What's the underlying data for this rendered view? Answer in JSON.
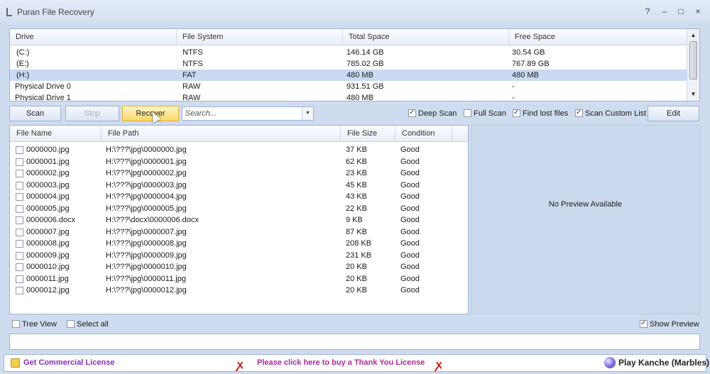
{
  "window": {
    "title": "Puran File Recovery",
    "controls": {
      "help": "?",
      "minimize": "–",
      "maximize": "□",
      "close": "×"
    }
  },
  "drives": {
    "headers": [
      "Drive",
      "File System",
      "Total Space",
      "Free Space"
    ],
    "rows": [
      {
        "drive": "(C:)",
        "fs": "NTFS",
        "total": "146.14 GB",
        "free": "30.54 GB"
      },
      {
        "drive": "(E:)",
        "fs": "NTFS",
        "total": "785.02 GB",
        "free": "767.89 GB"
      },
      {
        "drive": "(H:)",
        "fs": "FAT",
        "total": "480 MB",
        "free": "480 MB"
      },
      {
        "drive": "Physical Drive 0",
        "fs": "RAW",
        "total": "931.51 GB",
        "free": "-"
      },
      {
        "drive": "Physical Drive 1",
        "fs": "RAW",
        "total": "480 MB",
        "free": "-"
      }
    ],
    "selected_index": 2
  },
  "toolbar": {
    "scan": "Scan",
    "stop": "Stop",
    "recover": "Recover",
    "search_placeholder": "Search...",
    "deep_scan": "Deep Scan",
    "full_scan": "Full Scan",
    "find_lost_files": "Find lost files",
    "scan_custom_list": "Scan Custom List",
    "edit": "Edit",
    "deep_scan_checked": true,
    "full_scan_checked": false,
    "find_lost_files_checked": true,
    "scan_custom_list_checked": true
  },
  "files": {
    "headers": [
      "File Name",
      "File Path",
      "File Size",
      "Condition"
    ],
    "rows": [
      {
        "name": "0000000.jpg",
        "path": "H:\\???\\jpg\\0000000.jpg",
        "size": "37 KB",
        "condition": "Good"
      },
      {
        "name": "0000001.jpg",
        "path": "H:\\???\\jpg\\0000001.jpg",
        "size": "62 KB",
        "condition": "Good"
      },
      {
        "name": "0000002.jpg",
        "path": "H:\\???\\jpg\\0000002.jpg",
        "size": "23 KB",
        "condition": "Good"
      },
      {
        "name": "0000003.jpg",
        "path": "H:\\???\\jpg\\0000003.jpg",
        "size": "45 KB",
        "condition": "Good"
      },
      {
        "name": "0000004.jpg",
        "path": "H:\\???\\jpg\\0000004.jpg",
        "size": "43 KB",
        "condition": "Good"
      },
      {
        "name": "0000005.jpg",
        "path": "H:\\???\\jpg\\0000005.jpg",
        "size": "22 KB",
        "condition": "Good"
      },
      {
        "name": "0000006.docx",
        "path": "H:\\???\\docx\\0000006.docx",
        "size": "9 KB",
        "condition": "Good"
      },
      {
        "name": "0000007.jpg",
        "path": "H:\\???\\jpg\\0000007.jpg",
        "size": "87 KB",
        "condition": "Good"
      },
      {
        "name": "0000008.jpg",
        "path": "H:\\???\\jpg\\0000008.jpg",
        "size": "208 KB",
        "condition": "Good"
      },
      {
        "name": "0000009.jpg",
        "path": "H:\\???\\jpg\\0000009.jpg",
        "size": "231 KB",
        "condition": "Good"
      },
      {
        "name": "0000010.jpg",
        "path": "H:\\???\\jpg\\0000010.jpg",
        "size": "20 KB",
        "condition": "Good"
      },
      {
        "name": "0000011.jpg",
        "path": "H:\\???\\jpg\\0000011.jpg",
        "size": "20 KB",
        "condition": "Good"
      },
      {
        "name": "0000012.jpg",
        "path": "H:\\???\\jpg\\0000012.jpg",
        "size": "20 KB",
        "condition": "Good"
      }
    ]
  },
  "preview": {
    "text": "No Preview Available"
  },
  "bottom": {
    "tree_view": "Tree View",
    "select_all": "Select all",
    "show_preview": "Show Preview",
    "tree_view_checked": false,
    "select_all_checked": false,
    "show_preview_checked": true
  },
  "footer": {
    "commercial": "Get Commercial License",
    "thank_you": "Please click here to buy a Thank You License",
    "game": "Play Kanche (Marbles)"
  },
  "colors": {
    "window_bg": "#cfdcf0",
    "selection": "#c9daf2",
    "preview_bg": "#cbd9ee",
    "recover_hot": "#fbd868",
    "footer_purple": "#8a2fb8",
    "footer_magenta": "#b0289a",
    "ribbon_red": "#d01a1a"
  },
  "icons": [
    "app-icon",
    "license-icon",
    "ribbon-icon",
    "marble-icon",
    "chevron-down-icon",
    "scroll-up-icon",
    "scroll-down-icon",
    "mouse-cursor-icon"
  ]
}
